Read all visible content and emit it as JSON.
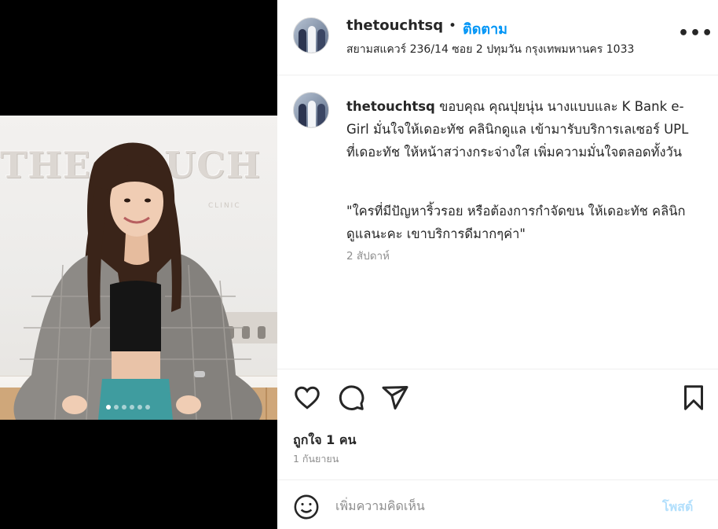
{
  "media": {
    "wall_logo": "THE TOUCH",
    "wall_sub": "CLINIC",
    "carousel_dots": 6,
    "active_dot": 0
  },
  "header": {
    "username": "thetouchtsq",
    "separator": "•",
    "follow_label": "ติดตาม",
    "location": "สยามสแควร์ 236/14 ซอย 2 ปทุมวัน กรุงเทพมหานคร 1033",
    "more_label": "•••"
  },
  "caption": {
    "username": "thetouchtsq",
    "text": "ขอบคุณ คุณปุยนุ่น นางแบบและ K Bank e-Girl มั่นใจให้เดอะทัช คลินิกดูแล เข้ามารับบริการเลเซอร์ UPL ที่เดอะทัช ให้หน้าสว่างกระจ่างใส เพิ่มความมั่นใจตลอดทั้งวัน",
    "quote": "\"ใครที่มีปัญหาริ้วรอย หรือต้องการกำจัดขน ให้เดอะทัช คลินิก ดูแลนะคะ เขาบริการดีมากๆค่า\"",
    "time_ago": "2 สัปดาห์"
  },
  "actions": {
    "icons": [
      "heart-icon",
      "comment-icon",
      "share-icon",
      "bookmark-icon"
    ],
    "likes_text": "ถูกใจ 1 คน",
    "date_text": "1 กันยายน"
  },
  "comment": {
    "placeholder": "เพิ่มความคิดเห็น",
    "post_label": "โพสต์",
    "emoji_icon": "smiley-icon"
  },
  "colors": {
    "accent": "#0095f6",
    "post_disabled": "#b2dffc",
    "muted": "#8e8e8e",
    "text": "#262626"
  }
}
